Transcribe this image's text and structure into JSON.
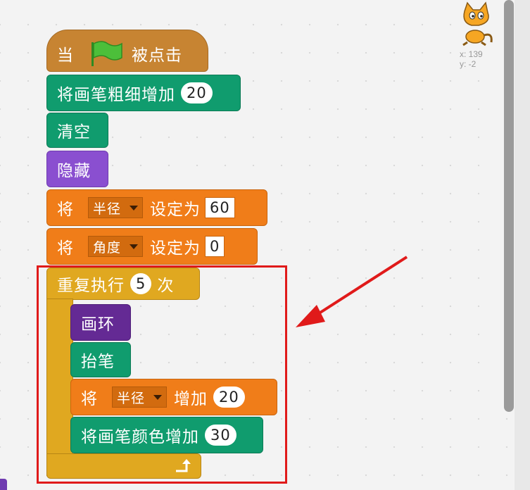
{
  "sprite": {
    "x_label": "x: 139",
    "y_label": "y: -2"
  },
  "blocks": {
    "hat": {
      "prefix": "当",
      "suffix": "被点击"
    },
    "pen_size": {
      "label": "将画笔粗细增加",
      "value": "20"
    },
    "clear": {
      "label": "清空"
    },
    "hide": {
      "label": "隐藏"
    },
    "set_radius": {
      "prefix": "将",
      "var": "半径",
      "mid": "设定为",
      "value": "60"
    },
    "set_angle": {
      "prefix": "将",
      "var": "角度",
      "mid": "设定为",
      "value": "0"
    },
    "repeat": {
      "label": "重复执行",
      "value": "5",
      "suffix": "次"
    },
    "draw_ring": {
      "label": "画环"
    },
    "pen_up": {
      "label": "抬笔"
    },
    "change_radius": {
      "prefix": "将",
      "var": "半径",
      "mid": "增加",
      "value": "20"
    },
    "pen_color": {
      "label": "将画笔颜色增加",
      "value": "30"
    }
  },
  "colors": {
    "pen": "#109c6e",
    "looks": "#8a4fd0",
    "variables": "#f07d19",
    "control": "#e0a820",
    "events": "#c78432",
    "more": "#642a94",
    "annotation": "#e01a1a"
  },
  "icons": [
    "green-flag-icon",
    "cat-sprite-icon",
    "loop-arrow-icon",
    "dropdown-arrow-icon",
    "red-arrow-icon"
  ]
}
